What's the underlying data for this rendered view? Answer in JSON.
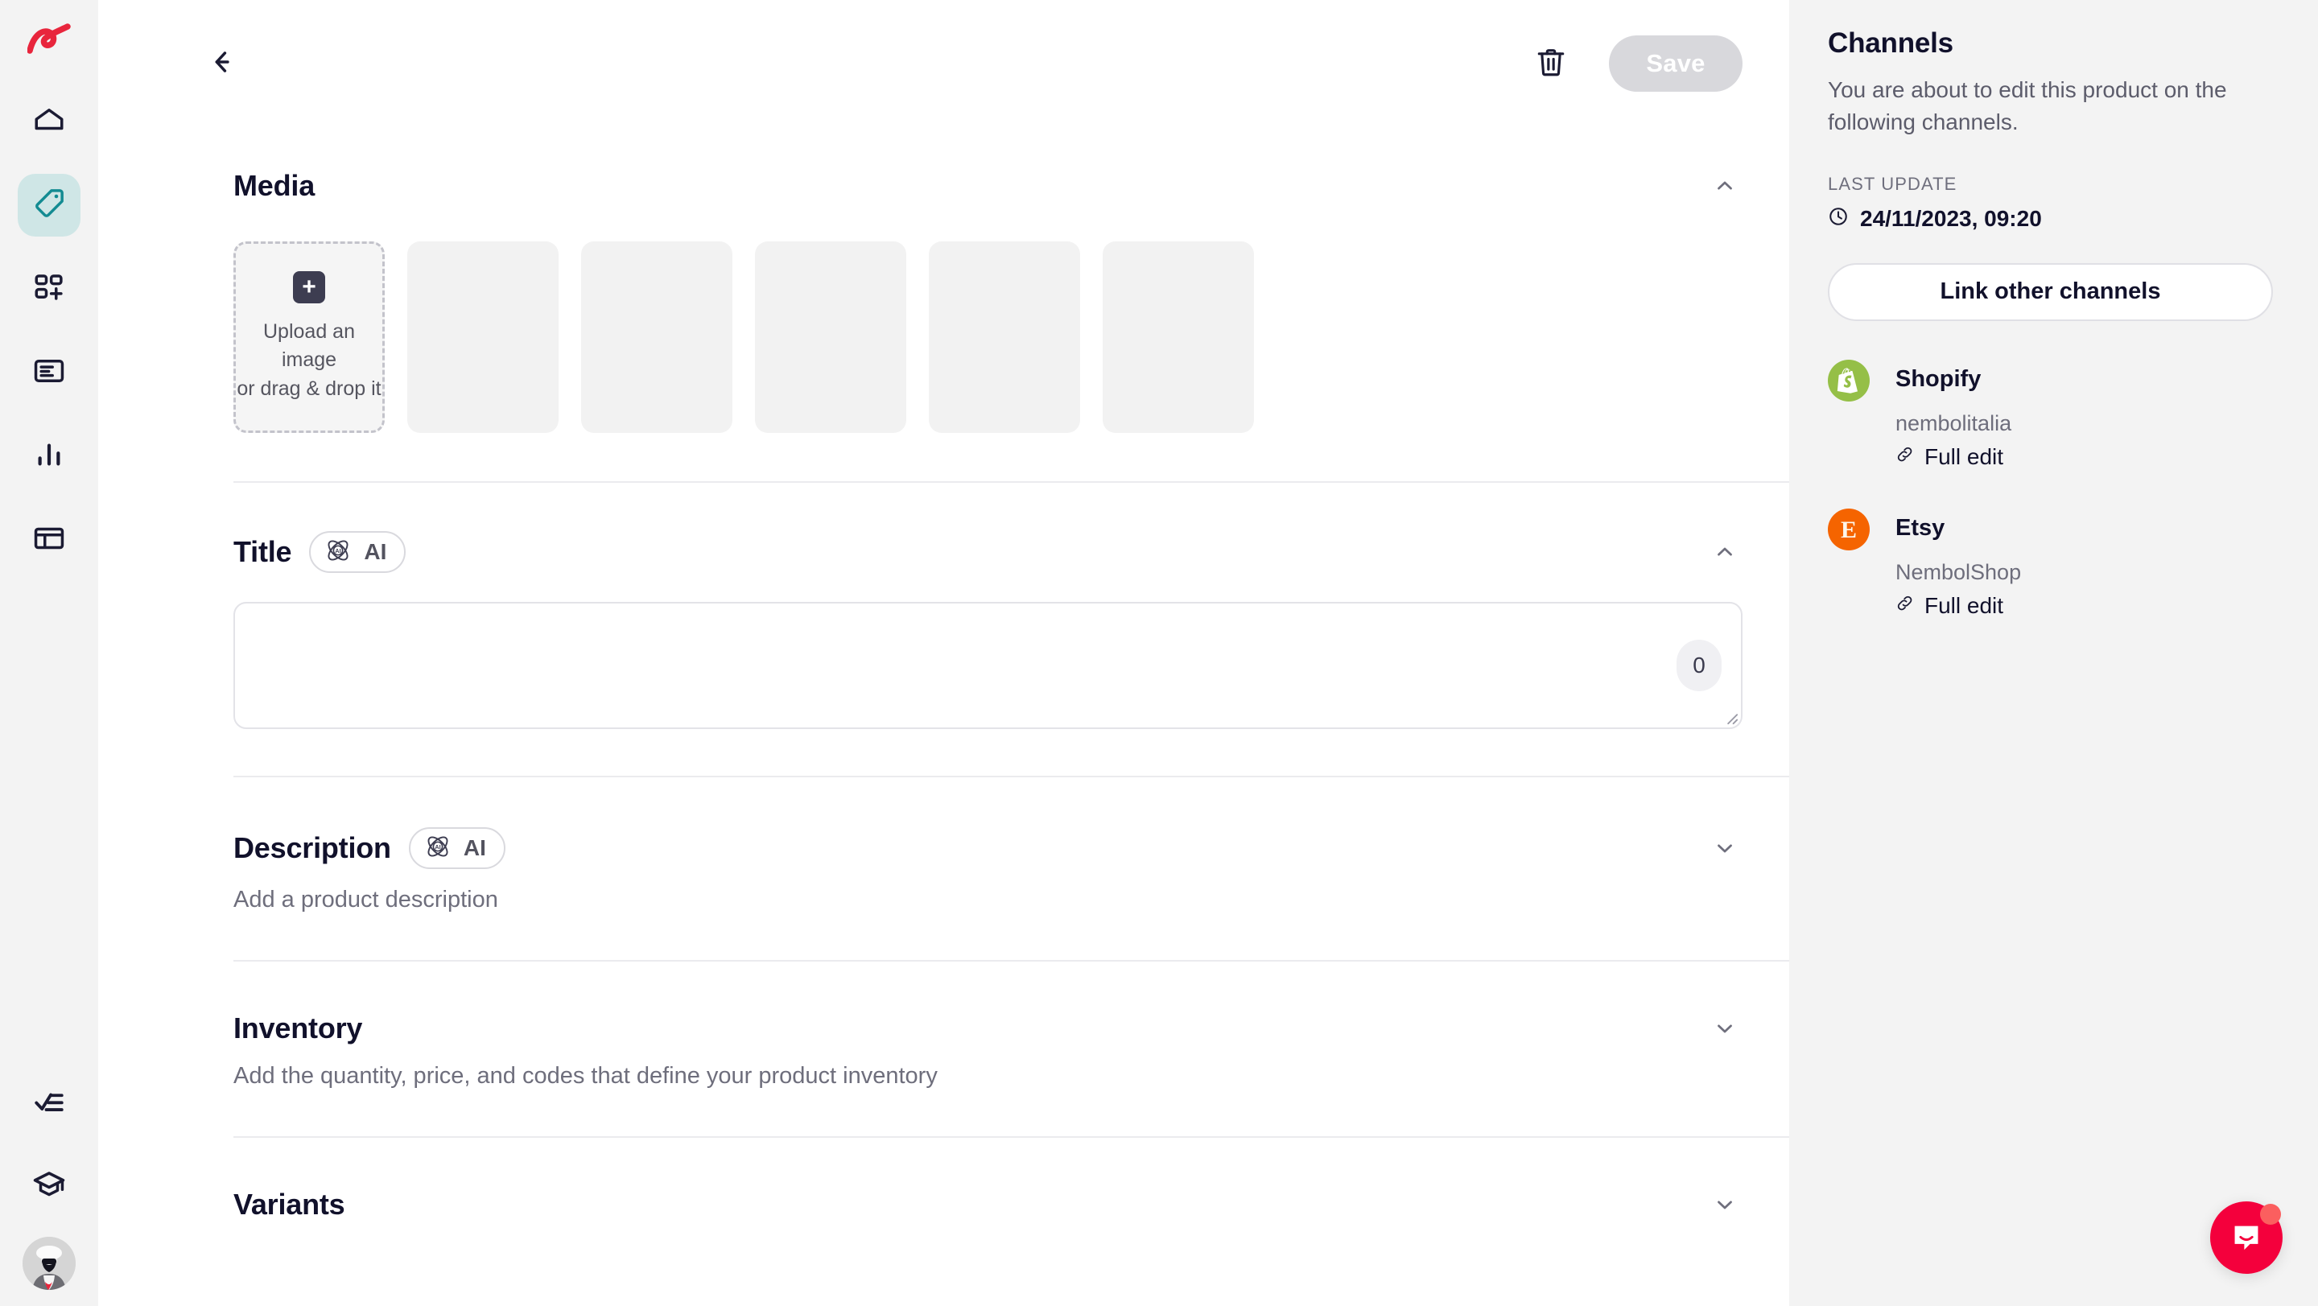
{
  "sidebar": {
    "logo_name": "nembol-logo",
    "items": [
      {
        "name": "home",
        "icon": "home-icon",
        "active": false
      },
      {
        "name": "products",
        "icon": "tag-icon",
        "active": true
      },
      {
        "name": "bulk-actions",
        "icon": "grid-plus-icon",
        "active": false
      },
      {
        "name": "orders",
        "icon": "document-list-icon",
        "active": false
      },
      {
        "name": "analytics",
        "icon": "bar-chart-icon",
        "active": false
      },
      {
        "name": "layout",
        "icon": "layout-icon",
        "active": false
      }
    ],
    "bottom_items": [
      {
        "name": "tasks",
        "icon": "checklist-icon"
      },
      {
        "name": "academy",
        "icon": "graduation-cap-icon"
      },
      {
        "name": "account",
        "icon": "avatar"
      }
    ]
  },
  "topbar": {
    "back_label": "back-arrow",
    "delete_label": "trash",
    "save_label": "Save",
    "save_disabled": true
  },
  "sections": {
    "media": {
      "title": "Media",
      "expanded": true,
      "chevron": "chevron-up",
      "upload": {
        "line1": "Upload an image",
        "line2": "or drag & drop it",
        "plus": "+"
      },
      "empty_slots": 5
    },
    "title": {
      "title": "Title",
      "ai_label": "AI",
      "expanded": true,
      "chevron": "chevron-up",
      "value": "",
      "placeholder": "",
      "char_count": "0"
    },
    "description": {
      "title": "Description",
      "ai_label": "AI",
      "expanded": false,
      "chevron": "chevron-down",
      "subtitle": "Add a product description"
    },
    "inventory": {
      "title": "Inventory",
      "expanded": false,
      "chevron": "chevron-down",
      "subtitle": "Add the quantity, price, and codes that define your product inventory"
    },
    "variants": {
      "title": "Variants",
      "expanded": false,
      "chevron": "chevron-down"
    }
  },
  "right_panel": {
    "title": "Channels",
    "subtitle": "You are about to edit this product on the following channels.",
    "last_update_label": "LAST UPDATE",
    "last_update_value": "24/11/2023, 09:20",
    "link_button": "Link other channels",
    "channels": [
      {
        "name": "Shopify",
        "shop": "nembolitalia",
        "edit_label": "Full edit",
        "color": "#95bf47",
        "glyph": "S"
      },
      {
        "name": "Etsy",
        "shop": "NembolShop",
        "edit_label": "Full edit",
        "color": "#f56400",
        "glyph": "E"
      }
    ]
  },
  "intercom": {
    "name": "intercom-launcher",
    "color": "#f4003c",
    "badge_color": "#fb5f5f"
  },
  "colors": {
    "rail_bg": "#f3f3f3",
    "panel_bg": "#f3f3f3",
    "accent_active": "#cfe6e6",
    "accent_icon": "#138b92",
    "brand_red": "#e8253c",
    "text_dark": "#11112b",
    "text_muted": "#6e6e7c"
  }
}
